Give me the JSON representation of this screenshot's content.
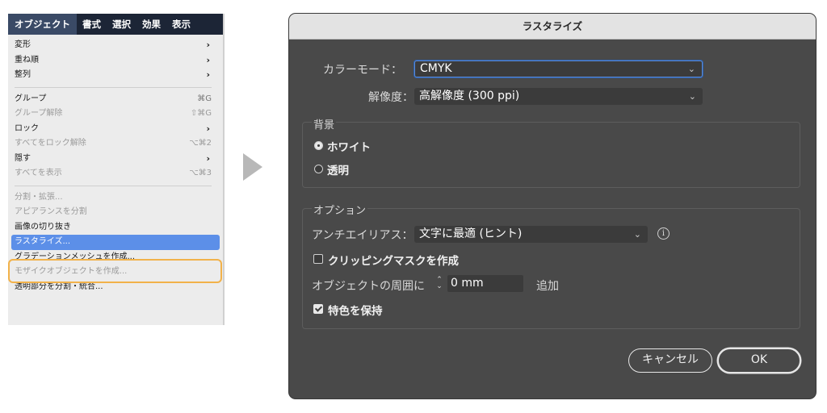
{
  "menubar": {
    "items": [
      "オブジェクト",
      "書式",
      "選択",
      "効果",
      "表示"
    ]
  },
  "menu": {
    "items": [
      {
        "label": "変形",
        "shortcut": "",
        "submenu": true,
        "enabled": true
      },
      {
        "label": "重ね順",
        "shortcut": "",
        "submenu": true,
        "enabled": true
      },
      {
        "label": "整列",
        "shortcut": "",
        "submenu": true,
        "enabled": true
      },
      {
        "label": "グループ",
        "shortcut": "⌘G",
        "submenu": false,
        "enabled": true
      },
      {
        "label": "グループ解除",
        "shortcut": "⇧⌘G",
        "submenu": false,
        "enabled": false
      },
      {
        "label": "ロック",
        "shortcut": "",
        "submenu": true,
        "enabled": true
      },
      {
        "label": "すべてをロック解除",
        "shortcut": "⌥⌘2",
        "submenu": false,
        "enabled": false
      },
      {
        "label": "隠す",
        "shortcut": "",
        "submenu": true,
        "enabled": true
      },
      {
        "label": "すべてを表示",
        "shortcut": "⌥⌘3",
        "submenu": false,
        "enabled": false
      },
      {
        "label": "分割・拡張...",
        "shortcut": "",
        "submenu": false,
        "enabled": false
      },
      {
        "label": "アピアランスを分割",
        "shortcut": "",
        "submenu": false,
        "enabled": false
      },
      {
        "label": "画像の切り抜き",
        "shortcut": "",
        "submenu": false,
        "enabled": true
      },
      {
        "label": "ラスタライズ...",
        "shortcut": "",
        "submenu": false,
        "enabled": true
      },
      {
        "label": "グラデーションメッシュを作成...",
        "shortcut": "",
        "submenu": false,
        "enabled": true
      },
      {
        "label": "モザイクオブジェクトを作成...",
        "shortcut": "",
        "submenu": false,
        "enabled": false
      },
      {
        "label": "透明部分を分割・統合...",
        "shortcut": "",
        "submenu": false,
        "enabled": true
      }
    ]
  },
  "dialog": {
    "title": "ラスタライズ",
    "color_mode": {
      "label": "カラーモード：",
      "value": "CMYK"
    },
    "resolution": {
      "label": "解像度：",
      "value": "高解像度 (300 ppi)"
    },
    "background": {
      "legend": "背景",
      "white": "ホワイト",
      "transparent": "透明",
      "selected": "white"
    },
    "options": {
      "legend": "オプション",
      "antialias_label": "アンチエイリアス：",
      "antialias_value": "文字に最適 (ヒント)",
      "clipping_mask": "クリッピングマスクを作成",
      "clipping_mask_checked": false,
      "padding_label": "オブジェクトの周囲に",
      "padding_value": "0 mm",
      "padding_suffix": "追加",
      "keep_spot": "特色を保持",
      "keep_spot_checked": true
    },
    "cancel_label": "キャンセル",
    "ok_label": "OK"
  },
  "colors": {
    "menubar_bg": "#1c2536",
    "highlight": "#5c8fe8",
    "highlight_frame": "#f2b24a",
    "dialog_bg": "#494949"
  }
}
